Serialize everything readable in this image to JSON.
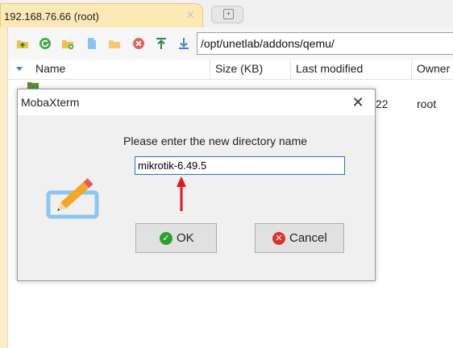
{
  "tab": {
    "title": "192.168.76.66 (root)",
    "close_glyph": "✕",
    "new_tab_glyph": "+"
  },
  "toolbar": {
    "icons": [
      "upload-folder-icon",
      "refresh-icon",
      "new-folder-icon",
      "new-file-icon",
      "open-folder-icon",
      "delete-icon",
      "upload-icon",
      "download-icon"
    ],
    "path": "/opt/unetlab/addons/qemu/"
  },
  "file_list": {
    "columns": [
      "Name",
      "Size (KB)",
      "Last modified",
      "Owner"
    ],
    "visible_fragments": {
      "modified_tail": "22",
      "owner": "root"
    }
  },
  "dialog": {
    "title": "MobaXterm",
    "close_glyph": "✕",
    "prompt": "Please enter the new directory name",
    "input_value": "mikrotik-6.49.5",
    "ok_label": "OK",
    "cancel_label": "Cancel",
    "ok_glyph": "✓",
    "cancel_glyph": "✕"
  },
  "colors": {
    "accent_tab": "#fde9b6",
    "input_focus": "#2c71c9",
    "ok_green": "#2ca02c",
    "cancel_red": "#d9342b",
    "annotation_arrow": "#e3151a"
  }
}
